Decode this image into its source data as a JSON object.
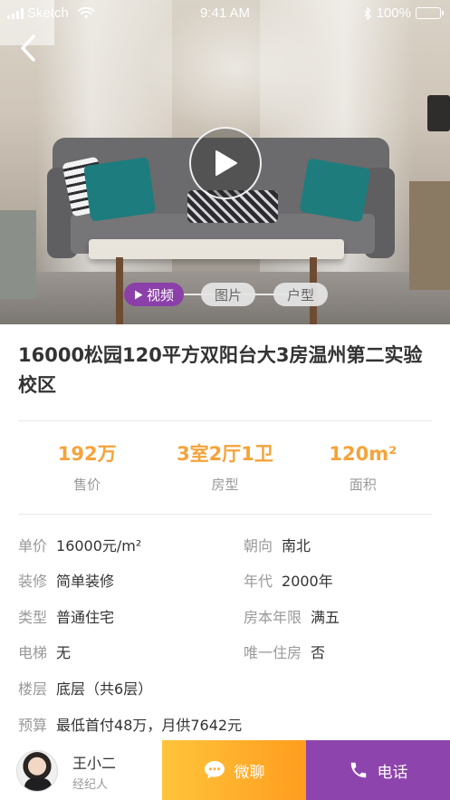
{
  "status_bar": {
    "carrier": "Sketch",
    "time": "9:41 AM",
    "battery": "100%"
  },
  "hero": {
    "image_icon": "living-room-photo",
    "play_icon": "play-icon",
    "back_icon": "chevron-left-icon",
    "media_tabs": [
      {
        "label": "视频",
        "active": true
      },
      {
        "label": "图片",
        "active": false
      },
      {
        "label": "户型",
        "active": false
      }
    ]
  },
  "listing": {
    "title": "16000松园120平方双阳台大3房温州第二实验校区",
    "stats": [
      {
        "value": "192万",
        "label": "售价"
      },
      {
        "value": "3室2厅1卫",
        "label": "房型"
      },
      {
        "value": "120m²",
        "label": "面积"
      }
    ],
    "details": [
      {
        "key": "单价",
        "value": "16000元/m²"
      },
      {
        "key": "朝向",
        "value": "南北"
      },
      {
        "key": "装修",
        "value": "简单装修"
      },
      {
        "key": "年代",
        "value": "2000年"
      },
      {
        "key": "类型",
        "value": "普通住宅"
      },
      {
        "key": "房本年限",
        "value": "满五"
      },
      {
        "key": "电梯",
        "value": "无"
      },
      {
        "key": "唯一住房",
        "value": "否"
      },
      {
        "key": "楼层",
        "value": "底层（共6层）"
      },
      {
        "key": "预算",
        "value": "最低首付48万，月供7642元"
      }
    ]
  },
  "bottom_bar": {
    "agent_name": "王小二",
    "agent_role": "经纪人",
    "wechat_label": "微聊",
    "call_label": "电话"
  },
  "colors": {
    "accent_purple": "#8e44ad",
    "accent_orange": "#f5a33b",
    "wechat_gradient_start": "#ffc43a",
    "wechat_gradient_end": "#ff9d1f"
  }
}
